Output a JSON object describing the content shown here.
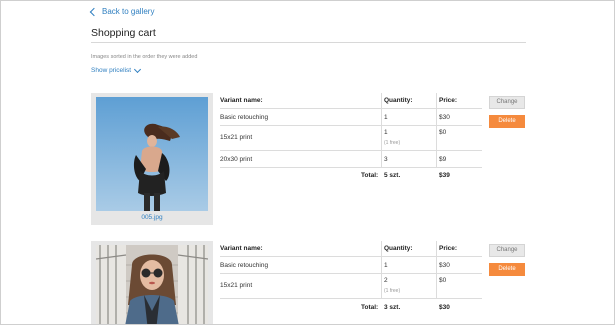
{
  "nav": {
    "back_label": "Back to gallery"
  },
  "page": {
    "title": "Shopping cart",
    "sort_note": "Images sorted in the order they were added",
    "pricelist_label": "Show pricelist"
  },
  "table_headers": {
    "variant": "Variant name:",
    "quantity": "Quantity:",
    "price": "Price:"
  },
  "buttons": {
    "change": "Change",
    "delete": "Delete"
  },
  "items": [
    {
      "filename": "005.jpg",
      "rows": [
        {
          "variant": "Basic retouching",
          "quantity": "1",
          "note": "",
          "price": "$30"
        },
        {
          "variant": "15x21 print",
          "quantity": "1",
          "note": "(1 free)",
          "price": "$0"
        },
        {
          "variant": "20x30 print",
          "quantity": "3",
          "note": "",
          "price": "$9"
        }
      ],
      "total_label": "Total:",
      "total_quantity": "5 szt.",
      "total_price": "$39"
    },
    {
      "filename": "",
      "rows": [
        {
          "variant": "Basic retouching",
          "quantity": "1",
          "note": "",
          "price": "$30"
        },
        {
          "variant": "15x21 print",
          "quantity": "2",
          "note": "(1 free)",
          "price": "$0"
        }
      ],
      "total_label": "Total:",
      "total_quantity": "3 szt.",
      "total_price": "$30"
    }
  ],
  "colors": {
    "link": "#2f7fc0",
    "delete_button": "#f58a3d",
    "thumb_bg": "#e6e6e6"
  },
  "icons": {
    "back": "chevron-left-icon",
    "pricelist": "chevron-down-icon"
  }
}
